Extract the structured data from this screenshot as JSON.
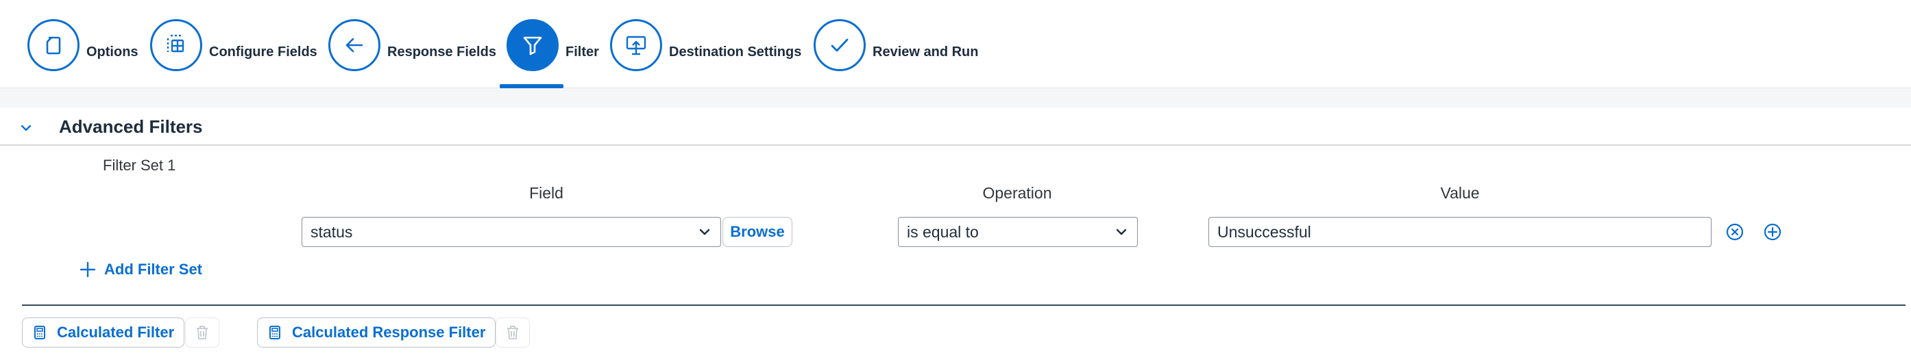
{
  "wizard": {
    "steps": [
      {
        "label": "Options",
        "icon": "document-icon",
        "active": false
      },
      {
        "label": "Configure Fields",
        "icon": "table-grid-icon",
        "active": false
      },
      {
        "label": "Response Fields",
        "icon": "arrow-left-icon",
        "active": false
      },
      {
        "label": "Filter",
        "icon": "filter-icon",
        "active": true
      },
      {
        "label": "Destination Settings",
        "icon": "upload-board-icon",
        "active": false
      },
      {
        "label": "Review and Run",
        "icon": "checkmark-icon",
        "active": false
      }
    ]
  },
  "panel": {
    "title": "Advanced Filters",
    "filter_set": {
      "title": "Filter Set 1",
      "columns": {
        "field": "Field",
        "operation": "Operation",
        "value": "Value"
      },
      "field_value": "status",
      "browse_label": "Browse",
      "operation_value": "is equal to",
      "value_value": "Unsuccessful"
    },
    "add_filter_set_label": "Add Filter Set",
    "calculated_filter_label": "Calculated Filter",
    "calculated_response_filter_label": "Calculated Response Filter"
  },
  "colors": {
    "accent": "#0a6ed1",
    "text": "#1d2d3e",
    "disabled_icon": "#c2c9d0"
  }
}
